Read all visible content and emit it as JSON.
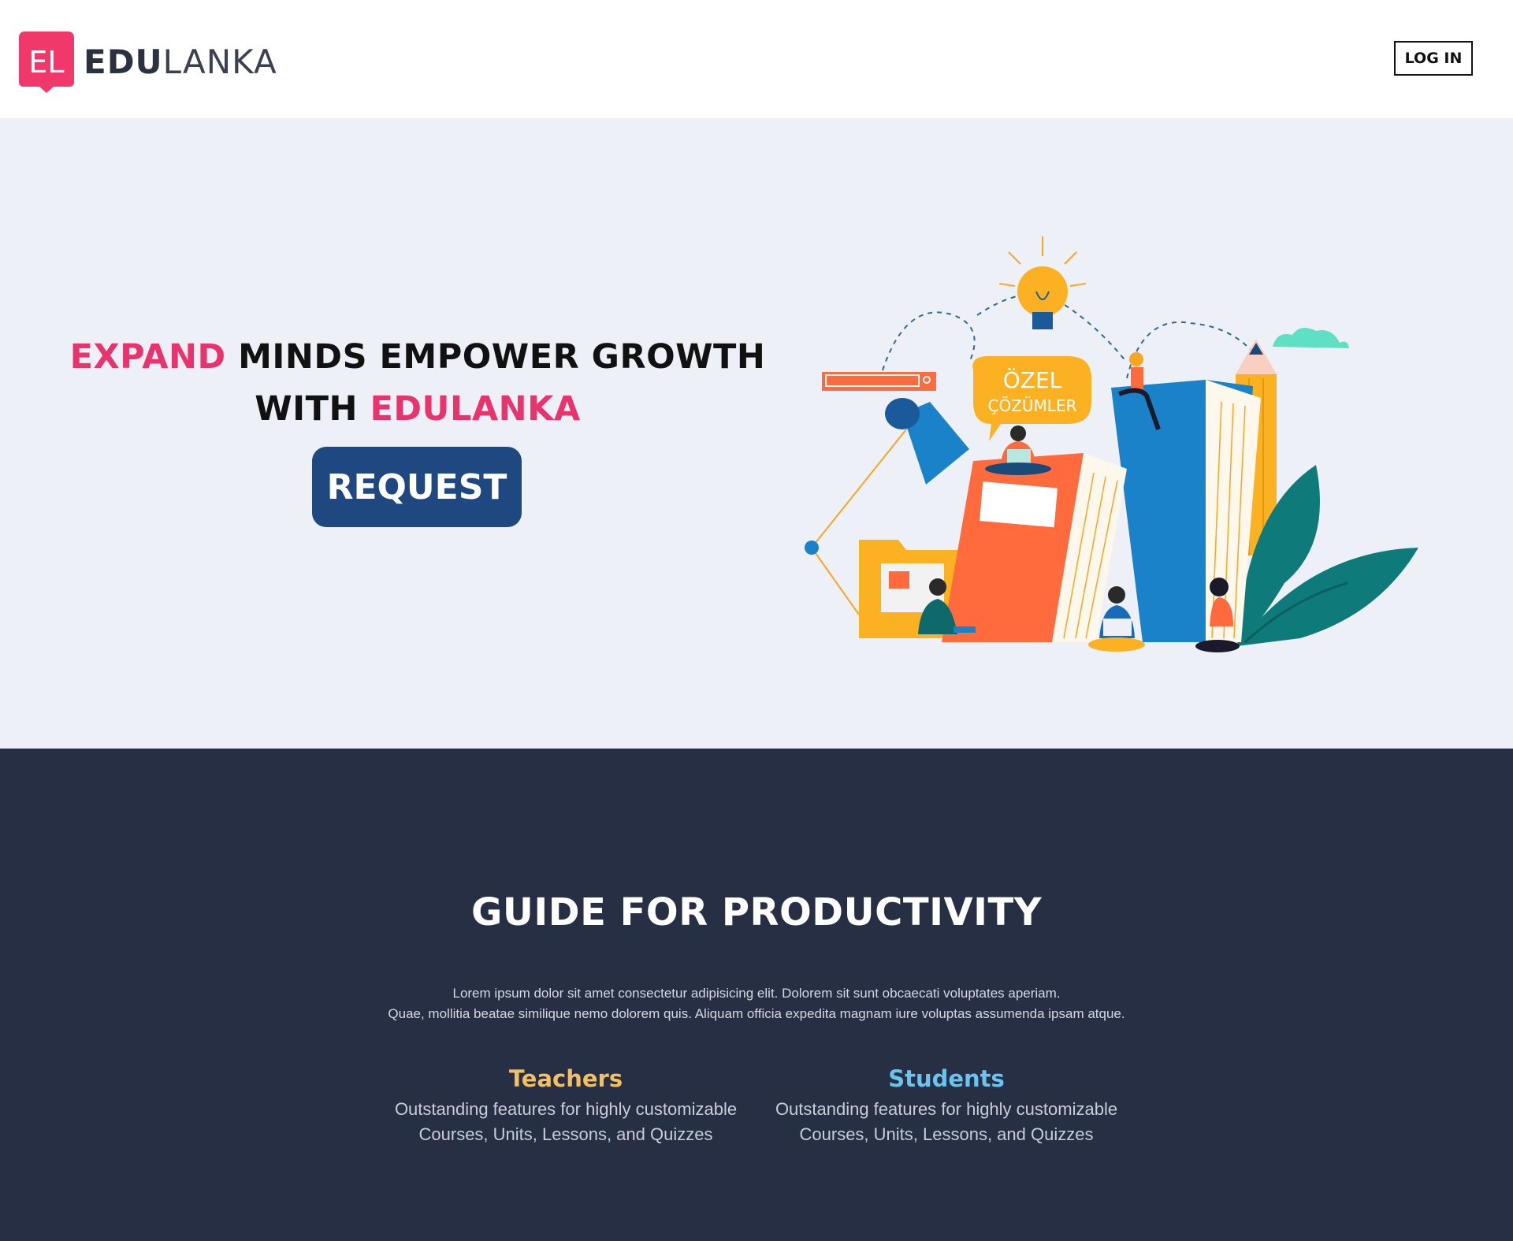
{
  "navbar": {
    "logo_letters": "EL",
    "brand_bold": "EDU",
    "brand_light": "LANKA",
    "login_label": "LOG IN"
  },
  "hero": {
    "title_accent_1": "EXPAND",
    "title_rest_1": "MINDS EMPOWER GROWTH",
    "title_with": "WITH",
    "title_accent_2": "EDULANKA",
    "request_label": "REQUEST",
    "illustration": {
      "bubble_line_1": "ÖZEL",
      "bubble_line_2": "ÇÖZÜMLER"
    }
  },
  "guide": {
    "title": "GUIDE FOR PRODUCTIVITY",
    "desc_line_1": "Lorem ipsum dolor sit amet consectetur adipisicing elit. Dolorem sit sunt obcaecati voluptates aperiam.",
    "desc_line_2": "Quae, mollitia beatae similique nemo dolorem quis. Aliquam officia expedita magnam iure voluptas assumenda ipsam atque.",
    "features": [
      {
        "title": "Teachers",
        "line_1": "Outstanding features for highly customizable",
        "line_2": "Courses, Units, Lessons, and Quizzes"
      },
      {
        "title": "Students",
        "line_1": "Outstanding features for highly customizable",
        "line_2": "Courses, Units, Lessons, and Quizzes"
      }
    ]
  },
  "colors": {
    "brand_pink": "#e8336d",
    "request_blue": "#1f4880",
    "hero_bg": "#eef0f7",
    "guide_bg": "#272f45",
    "teachers_gold": "#f2c063",
    "students_blue": "#6cc3ee"
  }
}
